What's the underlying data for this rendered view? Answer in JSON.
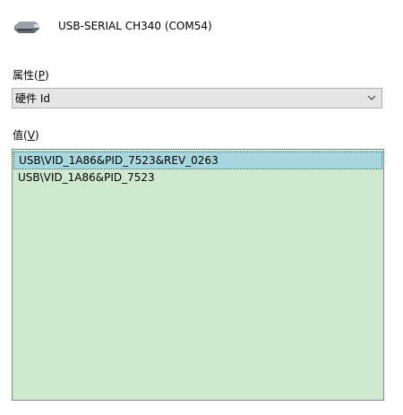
{
  "device": {
    "title": "USB-SERIAL CH340 (COM54)",
    "icon": "usb-serial-device-icon"
  },
  "property": {
    "label": "属性",
    "accelerator_open": "(",
    "accelerator_key": "P",
    "accelerator_close": ")",
    "selected": "硬件 Id"
  },
  "value": {
    "label": "值",
    "accelerator_open": "(",
    "accelerator_key": "V",
    "accelerator_close": ")",
    "items": [
      "USB\\VID_1A86&PID_7523&REV_0263",
      "USB\\VID_1A86&PID_7523"
    ]
  },
  "colors": {
    "list_background": "#cfe8d0",
    "selected_item": "#a9d7e0",
    "select_background": "#e5e5e5"
  }
}
